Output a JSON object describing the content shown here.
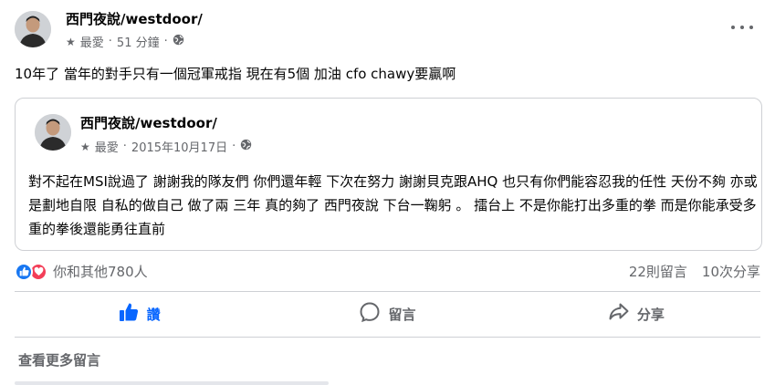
{
  "post": {
    "author": "西門夜說/westdoor/",
    "audience_label": "最愛",
    "separator": "·",
    "time": "51 分鐘",
    "text": "10年了 當年的對手只有一個冠軍戒指 現在有5個  加油 cfo chawy要贏啊",
    "icons": {
      "audience": "star-icon",
      "privacy": "globe-icon",
      "menu": "more-options-icon"
    }
  },
  "shared_post": {
    "author": "西門夜說/westdoor/",
    "audience_label": "最愛",
    "separator": "·",
    "date": "2015年10月17日",
    "text": "對不起在MSI說過了 謝謝我的隊友們 你們還年輕 下次在努力 謝謝貝克跟AHQ 也只有你們能容忍我的任性 天份不夠 亦或是劃地自限 自私的做自己 做了兩 三年 真的夠了 西門夜說 下台一鞠躬 。 擂台上 不是你能打出多重的拳 而是你能承受多重的拳後還能勇往直前"
  },
  "reactions": {
    "summary": "你和其他780人",
    "types": [
      "like-icon",
      "love-icon"
    ],
    "colors": {
      "like": "#1877f2",
      "love": "#f33e58"
    }
  },
  "stats": {
    "comments": "22則留言",
    "shares": "10次分享"
  },
  "actions": {
    "like_label": "讚",
    "comment_label": "留言",
    "share_label": "分享",
    "like_active_color": "#0866ff"
  },
  "comments": {
    "view_more_label": "查看更多留言"
  }
}
